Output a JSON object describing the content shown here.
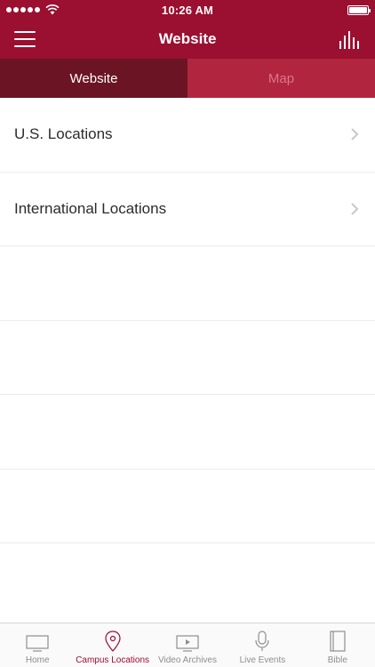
{
  "status": {
    "time": "10:26 AM"
  },
  "nav": {
    "title": "Website"
  },
  "segments": [
    {
      "label": "Website",
      "active": true
    },
    {
      "label": "Map",
      "active": false
    }
  ],
  "list": [
    {
      "label": "U.S. Locations"
    },
    {
      "label": "International Locations"
    }
  ],
  "tabs": [
    {
      "label": "Home",
      "icon": "tv-icon"
    },
    {
      "label": "Campus Locations",
      "icon": "location-pin-icon",
      "active": true
    },
    {
      "label": "Video Archives",
      "icon": "video-play-icon"
    },
    {
      "label": "Live Events",
      "icon": "microphone-icon"
    },
    {
      "label": "Bible",
      "icon": "book-icon"
    }
  ],
  "colors": {
    "accent": "#9b0f30",
    "segment_active": "#6b1424",
    "segment_inactive": "#b2253f"
  }
}
